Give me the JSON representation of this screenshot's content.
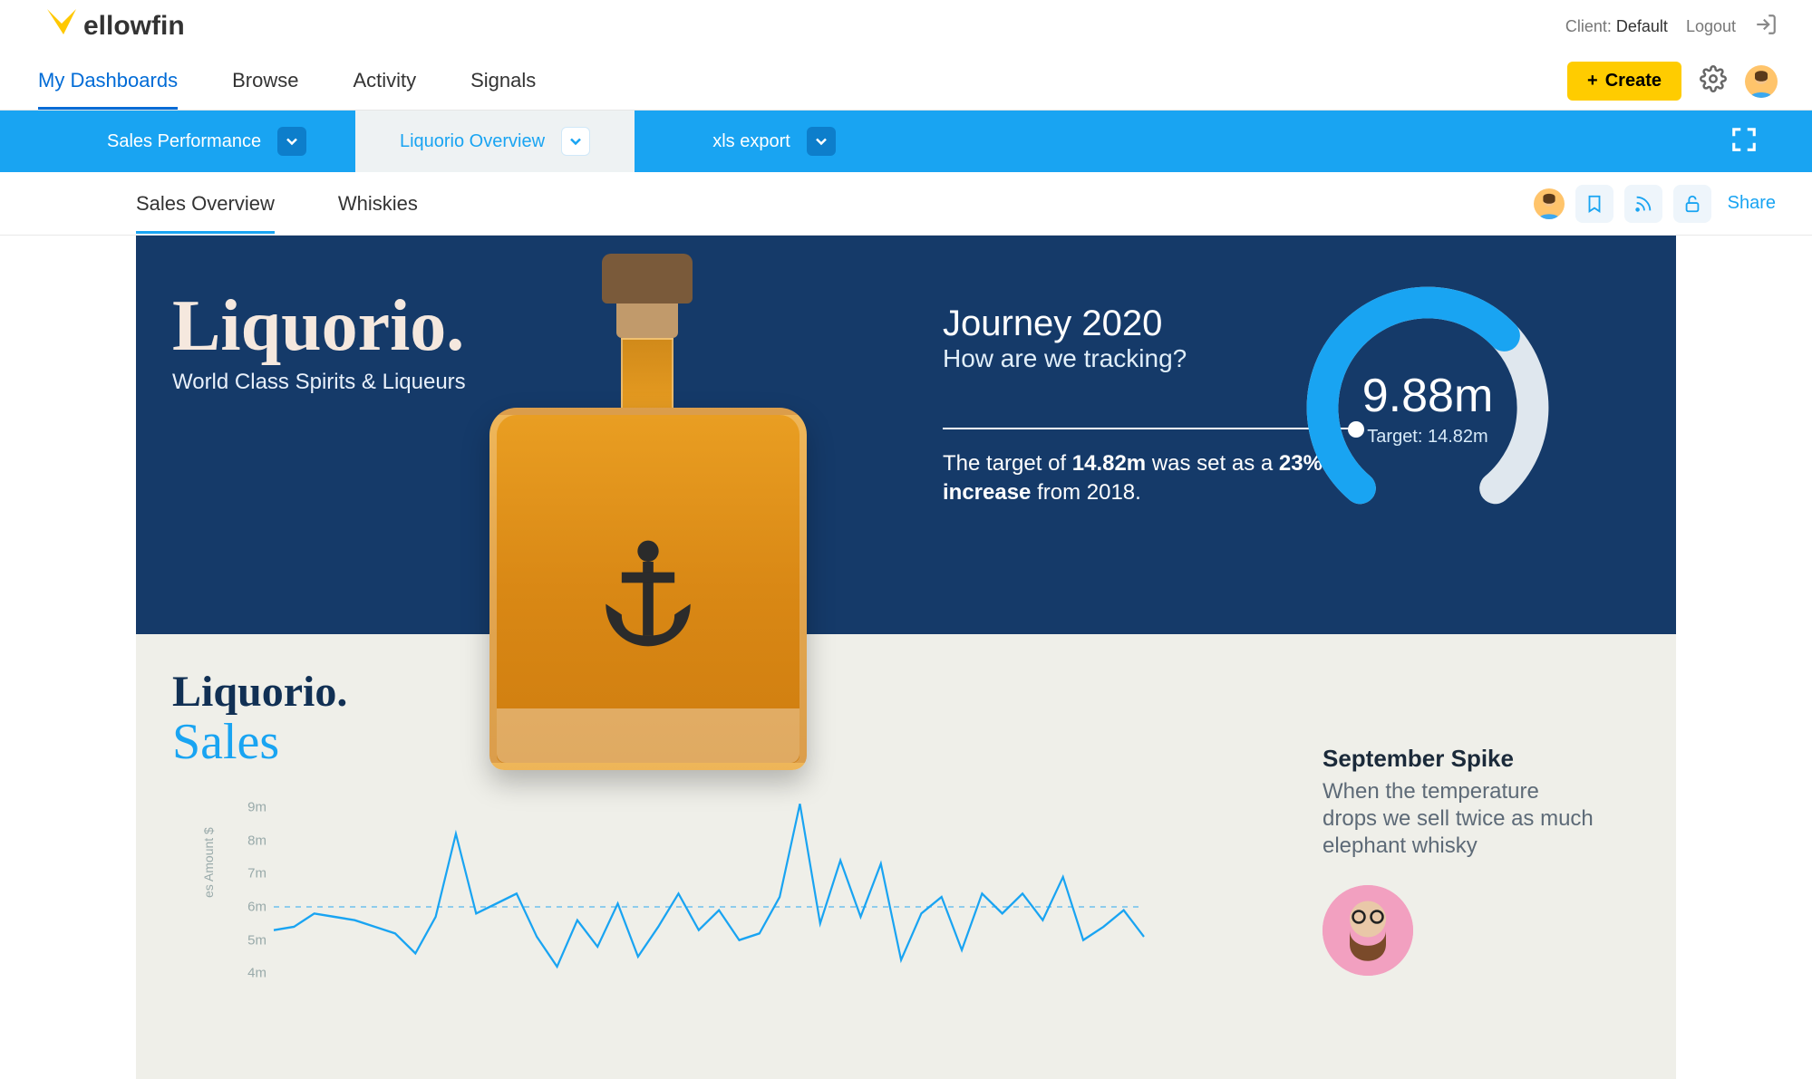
{
  "header": {
    "logo_text": "ellowfin",
    "client_label": "Client:",
    "client_value": "Default",
    "logout_label": "Logout"
  },
  "nav": {
    "items": [
      {
        "label": "My Dashboards",
        "active": true
      },
      {
        "label": "Browse",
        "active": false
      },
      {
        "label": "Activity",
        "active": false
      },
      {
        "label": "Signals",
        "active": false
      }
    ],
    "create_label": "Create"
  },
  "tab_strip": {
    "tabs": [
      {
        "label": "Sales Performance",
        "active": false
      },
      {
        "label": "Liquorio Overview",
        "active": true
      },
      {
        "label": "xls export",
        "active": false
      }
    ]
  },
  "subtabs": {
    "items": [
      {
        "label": "Sales Overview",
        "active": true
      },
      {
        "label": "Whiskies",
        "active": false
      }
    ],
    "share_label": "Share"
  },
  "hero": {
    "title": "Liquorio.",
    "subtitle": "World Class  Spirits & Liqueurs",
    "journey_title": "Journey 2020",
    "journey_subtitle": "How are we tracking?",
    "journey_desc_pre": "The target of ",
    "journey_desc_b1": "14.82m",
    "journey_desc_mid": " was set as a ",
    "journey_desc_b2": "23% increase",
    "journey_desc_post": " from 2018.",
    "gauge_value": "9.88m",
    "gauge_target": "Target: 14.82m",
    "gauge_fraction": 0.667
  },
  "panel": {
    "title": "Liquorio.",
    "subtitle": "Sales",
    "annotation_title": "September Spike",
    "annotation_body": "When the temperature drops we sell twice as much elephant whisky",
    "y_axis_label": "es Amount $"
  },
  "chart_data": {
    "type": "line",
    "ylabel": "Amount $",
    "ylim": [
      3,
      9
    ],
    "y_ticks": [
      "9m",
      "8m",
      "7m",
      "6m",
      "5m",
      "4m"
    ],
    "reference_line": 6,
    "values": [
      5.3,
      5.4,
      5.8,
      5.7,
      5.6,
      5.4,
      5.2,
      4.6,
      5.7,
      8.2,
      5.8,
      6.1,
      6.4,
      5.1,
      4.2,
      5.6,
      4.8,
      6.1,
      4.5,
      5.4,
      6.4,
      5.3,
      5.9,
      5.0,
      5.2,
      6.3,
      9.1,
      5.5,
      7.4,
      5.7,
      7.3,
      4.4,
      5.8,
      6.3,
      4.7,
      6.4,
      5.8,
      6.4,
      5.6,
      6.9,
      5.0,
      5.4,
      5.9,
      5.1
    ]
  }
}
